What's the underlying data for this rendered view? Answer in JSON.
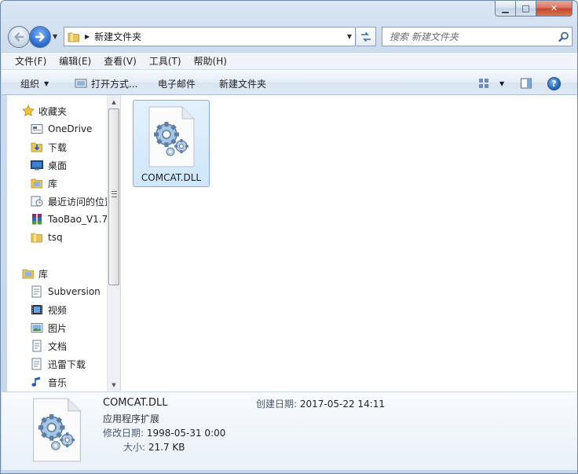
{
  "window": {
    "minimize": "▁",
    "maximize": "□",
    "close": "✕"
  },
  "address": {
    "crumb": "新建文件夹"
  },
  "search": {
    "placeholder": "搜索 新建文件夹"
  },
  "menu": [
    "文件(F)",
    "编辑(E)",
    "查看(V)",
    "工具(T)",
    "帮助(H)"
  ],
  "toolbar": {
    "organize": "组织",
    "open_with": "打开方式...",
    "email": "电子邮件",
    "new_folder": "新建文件夹",
    "help": "?"
  },
  "nav": {
    "favorites_label": "收藏夹",
    "favorites": [
      {
        "label": "OneDrive",
        "icon": "onedrive-icon"
      },
      {
        "label": "下载",
        "icon": "download-folder-icon"
      },
      {
        "label": "桌面",
        "icon": "desktop-icon"
      },
      {
        "label": "库",
        "icon": "library-icon"
      },
      {
        "label": "最近访问的位置",
        "icon": "recent-places-icon"
      },
      {
        "label": "TaoBao_V1.7",
        "icon": "archive-icon"
      },
      {
        "label": "tsq",
        "icon": "folder-icon"
      }
    ],
    "libraries_label": "库",
    "libraries": [
      {
        "label": "Subversion",
        "icon": "document-library-icon"
      },
      {
        "label": "视频",
        "icon": "video-icon"
      },
      {
        "label": "图片",
        "icon": "pictures-icon"
      },
      {
        "label": "文档",
        "icon": "documents-icon"
      },
      {
        "label": "迅雷下载",
        "icon": "document-library-icon"
      },
      {
        "label": "音乐",
        "icon": "music-icon"
      }
    ]
  },
  "files": [
    {
      "name": "COMCAT.DLL",
      "icon": "dll-file-icon"
    }
  ],
  "details": {
    "name": "COMCAT.DLL",
    "type": "应用程序扩展",
    "modified_label": "修改日期:",
    "modified": "1998-05-31 0:00",
    "size_label": "大小:",
    "size": "21.7 KB",
    "created_label": "创建日期:",
    "created": "2017-05-22 14:11"
  },
  "colors": {
    "accent": "#2c6ed0",
    "selection": "#cfe6fb",
    "toolbar": "#dfe8f4"
  }
}
